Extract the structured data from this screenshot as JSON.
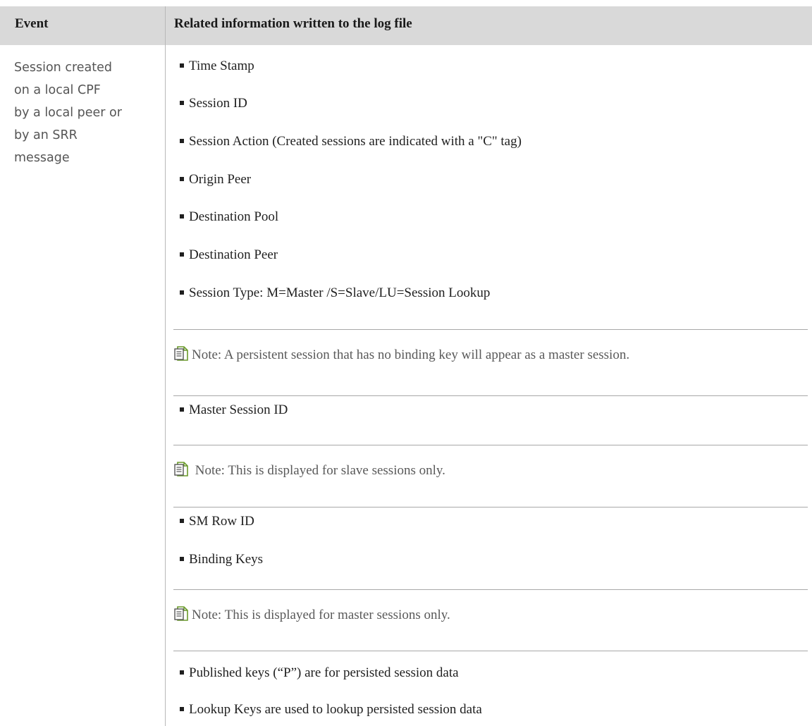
{
  "header": {
    "event": "Event",
    "info": "Related information written to the log file"
  },
  "event_lines": [
    "Session created",
    "on a local CPF",
    "by a local peer or",
    "by an SRR",
    "message"
  ],
  "items": {
    "time_stamp": "Time Stamp",
    "session_id": "Session ID",
    "session_action": "Session Action (Created sessions are indicated with a \"C\" tag)",
    "origin_peer": "Origin Peer",
    "destination_pool": "Destination Pool",
    "destination_peer": "Destination Peer",
    "session_type": "Session Type: M=Master /S=Slave/LU=Session Lookup",
    "master_session_id": "Master Session ID",
    "sm_row_id": "SM Row ID",
    "binding_keys": "Binding Keys",
    "published_keys": "Published keys (“P”) are for persisted session data",
    "lookup_keys": "Lookup Keys are used to lookup persisted session data"
  },
  "notes": {
    "persistent_session": "Note: A persistent session that has no binding key will appear as a master session.",
    "slave_only": " Note: This is displayed for slave sessions only.",
    "master_only": "Note: This is displayed for master sessions only."
  },
  "icons": {
    "note": "note-document-icon"
  },
  "colors": {
    "header_bg": "#d9d9d9",
    "rule": "#a8a8a8",
    "note_text": "#595959",
    "icon_green": "#6a9a2a"
  }
}
